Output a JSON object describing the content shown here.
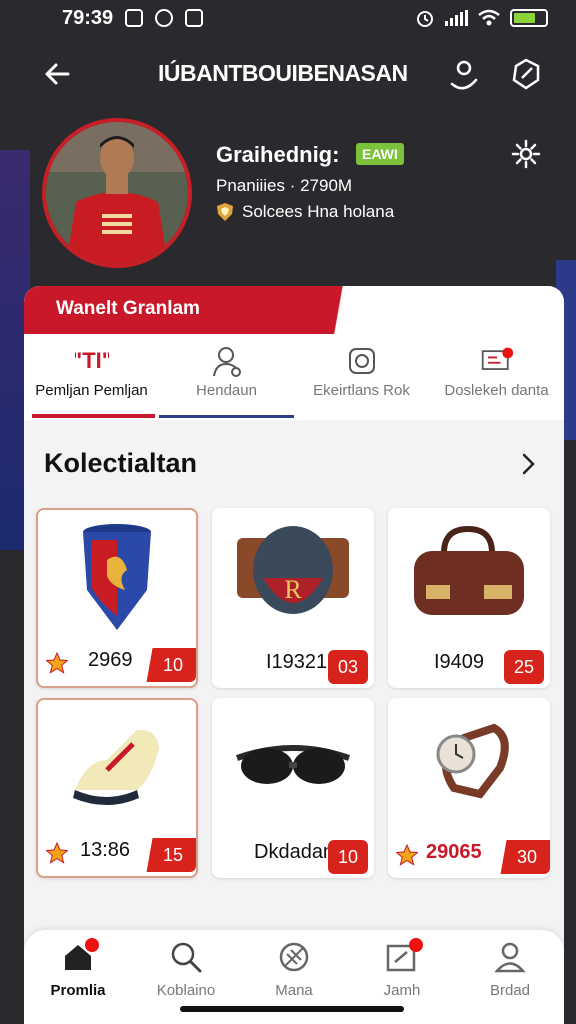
{
  "status_bar": {
    "time": "79:39",
    "accent": "#8bd23b"
  },
  "header": {
    "title": "IÚBANTBOUIBENASAN",
    "icons": [
      "back-arrow-icon",
      "user-icon",
      "edit-icon"
    ]
  },
  "profile": {
    "name": "Graihednig:",
    "badge": "EAWI",
    "points": "Pnaniiies · 2790M",
    "status": "Solcees Hna holana",
    "badge_color": "#7cc23a"
  },
  "banner": {
    "title": "Wanelt Granlam",
    "color": "#c8182a"
  },
  "tabs": [
    {
      "label": "Pemljan Pemljan",
      "icon": "trophy-icon",
      "active": true
    },
    {
      "label": "Hendaun",
      "icon": "user-search-icon",
      "active": false
    },
    {
      "label": "Ekeirtlans Rok",
      "icon": "camera-icon",
      "active": false
    },
    {
      "label": "Doslekeh danta",
      "icon": "message-icon",
      "active": false
    }
  ],
  "section": {
    "title": "Kolectialtan"
  },
  "items": [
    {
      "name": "shield-trophy",
      "value": "2969",
      "tag": "10",
      "starred": true,
      "highlight": true
    },
    {
      "name": "helmet",
      "value": "I19321",
      "tag": "03",
      "starred": false,
      "highlight": false
    },
    {
      "name": "leather-bag",
      "value": "I9409",
      "tag": "25",
      "starred": false,
      "highlight": false
    },
    {
      "name": "cleat-shoe",
      "value": "13:86",
      "tag": "15",
      "starred": true,
      "highlight": true
    },
    {
      "name": "goggles",
      "value": "Dkdadan",
      "tag": "10",
      "starred": false,
      "highlight": false
    },
    {
      "name": "wristwatch",
      "value": "29065",
      "tag": "30",
      "starred": true,
      "highlight": false
    }
  ],
  "bottom_nav": [
    {
      "label": "Promlia",
      "icon": "home-icon",
      "active": true,
      "dot": true
    },
    {
      "label": "Koblaino",
      "icon": "search-icon",
      "active": false,
      "dot": false
    },
    {
      "label": "Mana",
      "icon": "ball-icon",
      "active": false,
      "dot": false
    },
    {
      "label": "Jamh",
      "icon": "inbox-icon",
      "active": false,
      "dot": true
    },
    {
      "label": "Brdad",
      "icon": "profile-icon",
      "active": false,
      "dot": false
    }
  ]
}
